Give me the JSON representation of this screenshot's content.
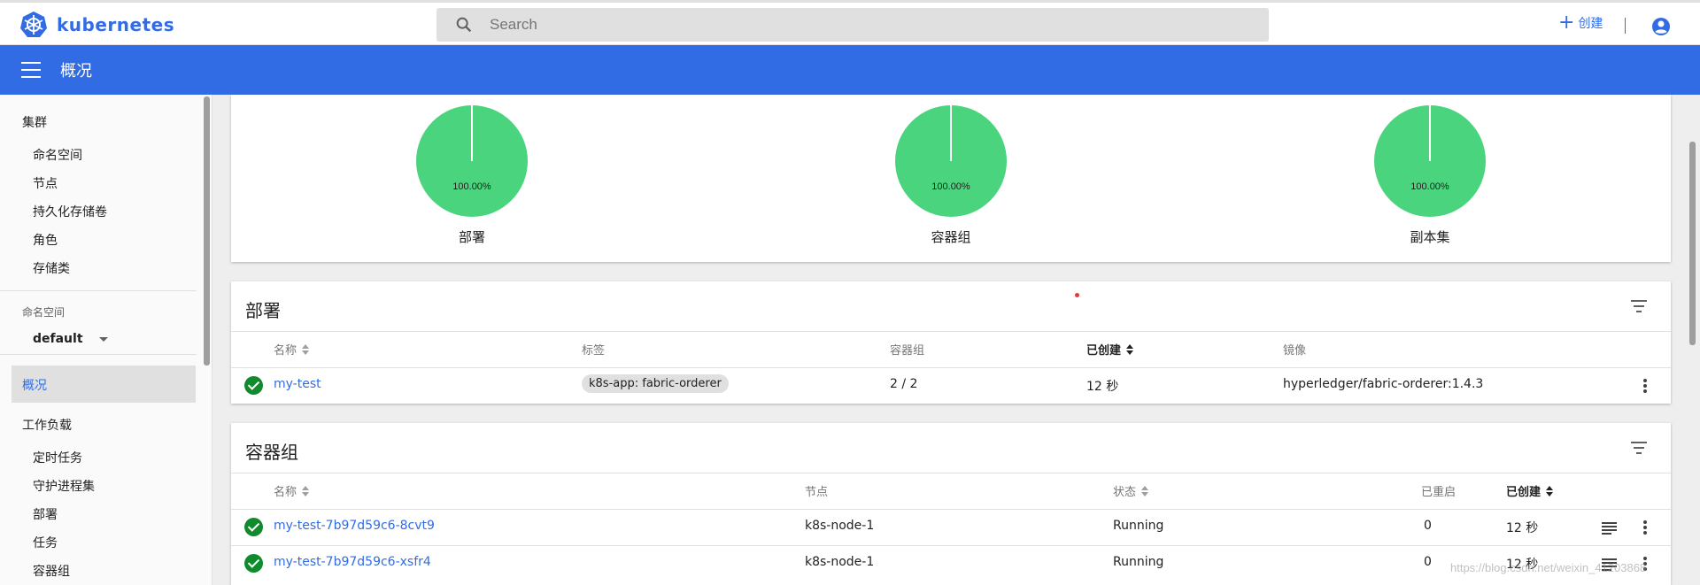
{
  "topbar": {
    "brand": "kubernetes",
    "search_placeholder": "Search",
    "create_label": "创建"
  },
  "header": {
    "title": "概况"
  },
  "sidebar": {
    "cluster": {
      "label": "集群",
      "items": [
        "命名空间",
        "节点",
        "持久化存储卷",
        "角色",
        "存储类"
      ]
    },
    "namespace": {
      "label": "命名空间",
      "selected": "default"
    },
    "overview": "概况",
    "workloads": {
      "label": "工作负载",
      "items": [
        "定时任务",
        "守护进程集",
        "部署",
        "任务",
        "容器组"
      ]
    }
  },
  "status_charts": [
    {
      "percent_label": "100.00%",
      "label": "部署",
      "value": 100
    },
    {
      "percent_label": "100.00%",
      "label": "容器组",
      "value": 100
    },
    {
      "percent_label": "100.00%",
      "label": "副本集",
      "value": 100
    }
  ],
  "deployments": {
    "title": "部署",
    "columns": [
      "名称",
      "标签",
      "容器组",
      "已创建",
      "镜像"
    ],
    "rows": [
      {
        "name": "my-test",
        "label": "k8s-app: fabric-orderer",
        "pods": "2 / 2",
        "created": "12 秒",
        "image": "hyperledger/fabric-orderer:1.4.3"
      }
    ]
  },
  "pods": {
    "title": "容器组",
    "columns": [
      "名称",
      "节点",
      "状态",
      "已重启",
      "已创建"
    ],
    "rows": [
      {
        "name": "my-test-7b97d59c6-8cvt9",
        "node": "k8s-node-1",
        "status": "Running",
        "restarts": "0",
        "created": "12 秒"
      },
      {
        "name": "my-test-7b97d59c6-xsfr4",
        "node": "k8s-node-1",
        "status": "Running",
        "restarts": "0",
        "created": "12 秒"
      }
    ]
  },
  "watermark": "https://blog.csdn.net/weixin_41203868",
  "colors": {
    "accent": "#326ce5",
    "success": "#0f8a2d",
    "pie_fill": "#4bd47e"
  }
}
